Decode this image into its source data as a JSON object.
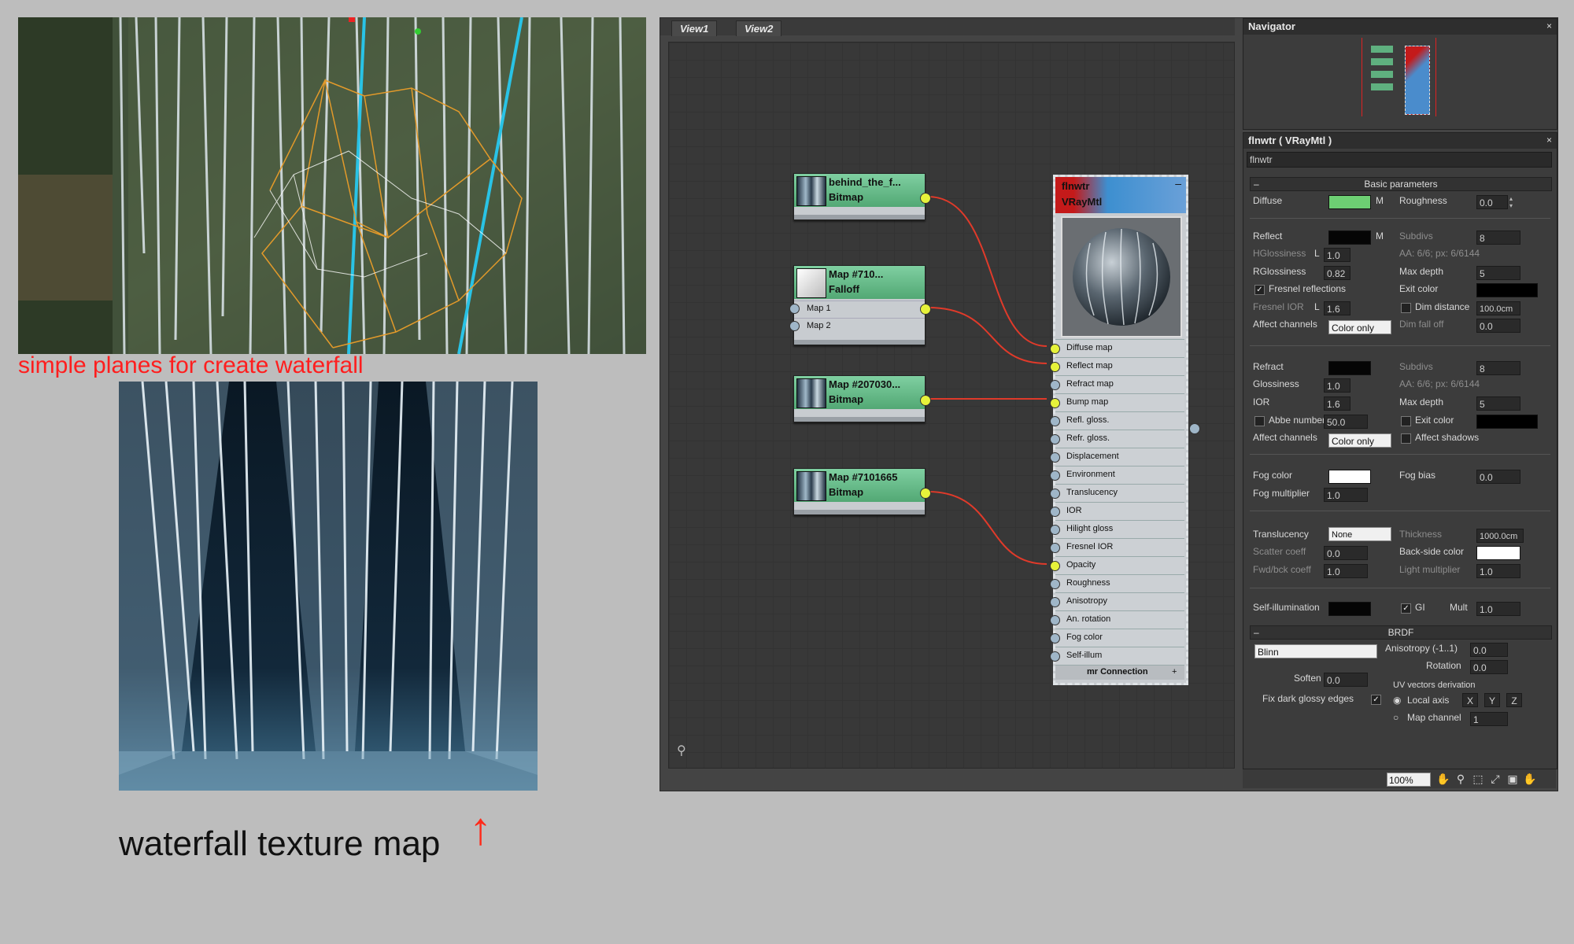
{
  "captions": {
    "viewport": "simple planes for create waterfall",
    "texture": "waterfall texture map",
    "arrow": "↑"
  },
  "editor": {
    "tabs": [
      "View1",
      "View2"
    ],
    "nodes": [
      {
        "title": "behind_the_f...",
        "type": "Bitmap"
      },
      {
        "title": "Map #710...",
        "type": "Falloff",
        "slots": [
          "Map 1",
          "Map 2"
        ]
      },
      {
        "title": "Map #207030...",
        "type": "Bitmap"
      },
      {
        "title": "Map #7101665",
        "type": "Bitmap"
      }
    ],
    "material_node": {
      "name": "flnwtr",
      "type": "VRayMtl",
      "slots": [
        "Diffuse map",
        "Reflect map",
        "Refract map",
        "Bump map",
        "Refl. gloss.",
        "Refr. gloss.",
        "Displacement",
        "Environment",
        "Translucency",
        "IOR",
        "Hilight gloss",
        "Fresnel IOR",
        "Opacity",
        "Roughness",
        "Anisotropy",
        "An. rotation",
        "Fog color",
        "Self-illum"
      ],
      "footer": "mr Connection",
      "footer_plus": "+"
    },
    "binoculars_icon": "binoculars-icon"
  },
  "navigator": {
    "title": "Navigator",
    "close": "×"
  },
  "params": {
    "title": "flnwtr  ( VRayMtl )",
    "close": "×",
    "name_field": "flnwtr",
    "basic_section": "Basic parameters",
    "collapse": "–",
    "diffuse": {
      "label": "Diffuse",
      "m": "M",
      "roughness_label": "Roughness",
      "roughness": "0.0",
      "color": "#6dcf73"
    },
    "reflect": {
      "label": "Reflect",
      "m": "M",
      "color": "#050505",
      "subdivs_label": "Subdivs",
      "subdivs": "8",
      "hglossiness_label": "HGlossiness",
      "l1": "L",
      "hglossiness": "1.0",
      "aa_text": "AA: 6/6; px: 6/6144",
      "rglossiness_label": "RGlossiness",
      "rglossiness": "0.82",
      "max_depth_label": "Max depth",
      "max_depth": "5",
      "fresnel_label": "Fresnel reflections",
      "fresnel_check": "✓",
      "exit_color_label": "Exit color",
      "exit_color": "#000000",
      "fresnel_ior_label": "Fresnel IOR",
      "l2": "L",
      "fresnel_ior": "1.6",
      "dim_distance_label": "Dim distance",
      "dim_distance": "100.0cm",
      "affect_label": "Affect channels",
      "affect": "Color only",
      "dim_falloff_label": "Dim fall off",
      "dim_falloff": "0.0"
    },
    "refract": {
      "label": "Refract",
      "color": "#050505",
      "subdivs_label": "Subdivs",
      "subdivs": "8",
      "glossiness_label": "Glossiness",
      "glossiness": "1.0",
      "aa_text": "AA: 6/6; px: 6/6144",
      "ior_label": "IOR",
      "ior": "1.6",
      "max_depth_label": "Max depth",
      "max_depth": "5",
      "abbe_label": "Abbe number",
      "abbe": "50.0",
      "exit_color_label": "Exit color",
      "exit_color": "#000000",
      "affect_label": "Affect channels",
      "affect": "Color only",
      "affect_shadows_label": "Affect shadows"
    },
    "fog": {
      "color_label": "Fog color",
      "color": "#ffffff",
      "bias_label": "Fog bias",
      "bias": "0.0",
      "multiplier_label": "Fog multiplier",
      "multiplier": "1.0"
    },
    "translucency": {
      "label": "Translucency",
      "value": "None",
      "thickness_label": "Thickness",
      "thickness": "1000.0cm",
      "scatter_label": "Scatter coeff",
      "scatter": "0.0",
      "backside_label": "Back-side color",
      "backside_color": "#ffffff",
      "fwdbck_label": "Fwd/bck coeff",
      "fwdbck": "1.0",
      "light_mult_label": "Light multiplier",
      "light_mult": "1.0"
    },
    "self_illum": {
      "label": "Self-illumination",
      "color": "#050505",
      "gi_label": "GI",
      "gi_check": "✓",
      "mult_label": "Mult",
      "mult": "1.0"
    },
    "brdf": {
      "section": "BRDF",
      "type": "Blinn",
      "anisotropy_label": "Anisotropy (-1..1)",
      "anisotropy": "0.0",
      "rotation_label": "Rotation",
      "rotation": "0.0",
      "soften_label": "Soften",
      "soften": "0.0",
      "uv_label": "UV vectors derivation",
      "fix_label": "Fix dark glossy edges",
      "fix_check": "✓",
      "local_axis_label": "Local axis",
      "x": "X",
      "y": "Y",
      "z": "Z",
      "map_channel_label": "Map channel",
      "map_channel": "1"
    }
  },
  "statusbar": {
    "zoom": "100%"
  }
}
